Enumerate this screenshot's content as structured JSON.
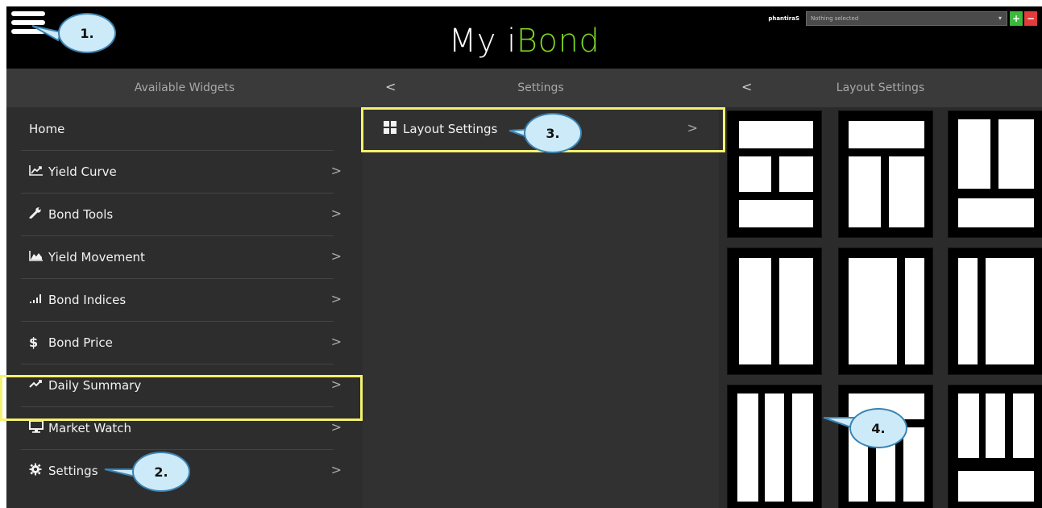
{
  "app": {
    "title_prefix": "My i",
    "title_accent": "Bond",
    "username": "phantiraS",
    "selector_placeholder": "Nothing selected",
    "add_label": "+",
    "remove_label": "−"
  },
  "panels": {
    "widgets": {
      "header": "Available Widgets",
      "items": [
        {
          "label": "Home",
          "icon": "",
          "has_chevron": false
        },
        {
          "label": "Yield Curve",
          "icon": "line-chart-icon",
          "has_chevron": true
        },
        {
          "label": "Bond Tools",
          "icon": "wrench-icon",
          "has_chevron": true
        },
        {
          "label": "Yield Movement",
          "icon": "area-chart-icon",
          "has_chevron": true
        },
        {
          "label": "Bond Indices",
          "icon": "signal-bars-icon",
          "has_chevron": true
        },
        {
          "label": "Bond Price",
          "icon": "dollar-icon",
          "has_chevron": true
        },
        {
          "label": "Daily Summary",
          "icon": "trend-icon",
          "has_chevron": true
        },
        {
          "label": "Market Watch",
          "icon": "monitor-icon",
          "has_chevron": true
        },
        {
          "label": "Settings",
          "icon": "gear-icon",
          "has_chevron": true
        }
      ]
    },
    "settings": {
      "header": "Settings",
      "items": [
        {
          "label": "Layout Settings",
          "icon": "grid-icon",
          "has_chevron": true
        }
      ]
    },
    "layout_settings": {
      "header": "Layout Settings",
      "layout_count": 9
    }
  },
  "callouts": [
    "1.",
    "2.",
    "3.",
    "4."
  ],
  "colors": {
    "accent": "#7dd321",
    "highlight": "#f4f170",
    "callout_fill": "#cdeaf8",
    "callout_border": "#3b83b2"
  }
}
